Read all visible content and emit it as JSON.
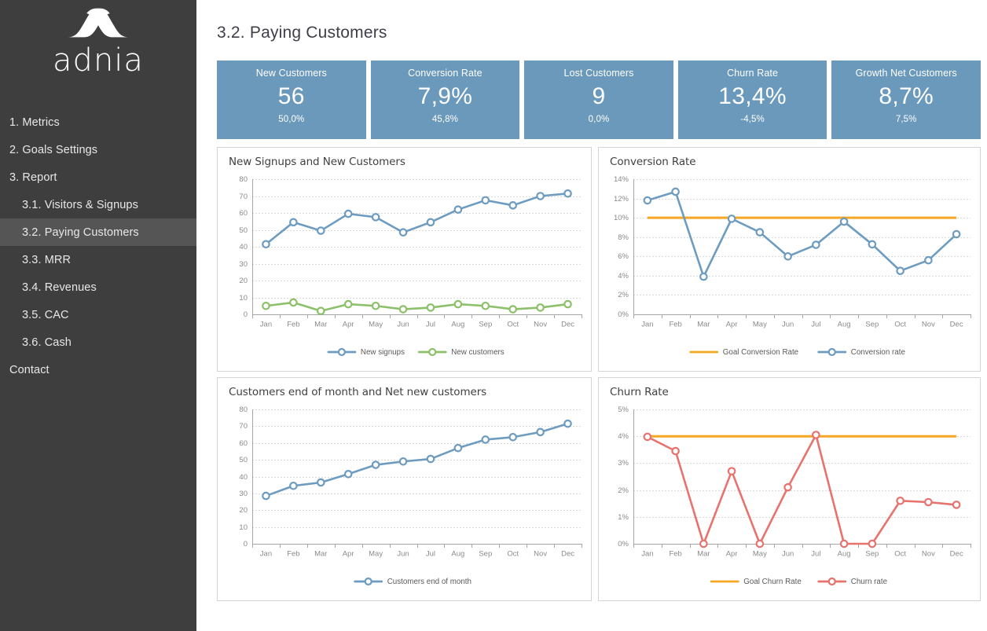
{
  "brand": {
    "name": "adnia",
    "logo_icon": "adnia-ribbon-logo"
  },
  "sidebar": {
    "items": [
      {
        "label": "1. Metrics",
        "level": 0,
        "active": false
      },
      {
        "label": "2. Goals Settings",
        "level": 0,
        "active": false
      },
      {
        "label": "3. Report",
        "level": 0,
        "active": false
      },
      {
        "label": "3.1. Visitors & Signups",
        "level": 1,
        "active": false
      },
      {
        "label": "3.2. Paying Customers",
        "level": 1,
        "active": true
      },
      {
        "label": "3.3. MRR",
        "level": 1,
        "active": false
      },
      {
        "label": "3.4. Revenues",
        "level": 1,
        "active": false
      },
      {
        "label": "3.5. CAC",
        "level": 1,
        "active": false
      },
      {
        "label": "3.6. Cash",
        "level": 1,
        "active": false
      },
      {
        "label": "Contact",
        "level": 0,
        "active": false
      }
    ]
  },
  "page": {
    "title": "3.2. Paying Customers"
  },
  "kpis": [
    {
      "label": "New Customers",
      "value": "56",
      "sub": "50,0%"
    },
    {
      "label": "Conversion Rate",
      "value": "7,9%",
      "sub": "45,8%"
    },
    {
      "label": "Lost Customers",
      "value": "9",
      "sub": "0,0%"
    },
    {
      "label": "Churn Rate",
      "value": "13,4%",
      "sub": "-4,5%"
    },
    {
      "label": "Growth Net Customers",
      "value": "8,7%",
      "sub": "7,5%"
    }
  ],
  "colors": {
    "kpi_card": "#6b99bb",
    "sidebar": "#3e3e3e",
    "sidebar_active": "#555555",
    "blue": "#6e9cc0",
    "green": "#8cc06a",
    "orange": "#f5a623",
    "red": "#e8736e",
    "grid": "#d9d9d9",
    "axis": "#a6a6a6",
    "tick_text": "#8a8a8a"
  },
  "chart_data": [
    {
      "id": "new-signups-and-new-customers",
      "type": "line",
      "title": "New Signups and New Customers",
      "categories": [
        "Jan",
        "Feb",
        "Mar",
        "Apr",
        "May",
        "Jun",
        "Jul",
        "Aug",
        "Sep",
        "Oct",
        "Nov",
        "Dec"
      ],
      "series": [
        {
          "name": "New signups",
          "color": "#6e9cc0",
          "marker": true,
          "values": [
            41.5,
            54.5,
            49.5,
            59.5,
            57.5,
            48.5,
            54.5,
            62,
            67.5,
            64.5,
            70,
            71.5
          ]
        },
        {
          "name": "New customers",
          "color": "#8cc06a",
          "marker": true,
          "values": [
            5,
            7,
            2,
            6,
            5,
            3,
            4,
            6,
            5,
            3,
            4,
            6
          ]
        }
      ],
      "ylim": [
        0,
        80
      ],
      "yticks": [
        0,
        10,
        20,
        30,
        40,
        50,
        60,
        70,
        80
      ],
      "ytick_labels": [
        "0",
        "10",
        "20",
        "30",
        "40",
        "50",
        "60",
        "70",
        "80"
      ],
      "xlabel": "",
      "ylabel": "",
      "grid": true,
      "legend": "bottom"
    },
    {
      "id": "conversion-rate",
      "type": "line",
      "title": "Conversion Rate",
      "categories": [
        "Jan",
        "Feb",
        "Mar",
        "Apr",
        "May",
        "Jun",
        "Jul",
        "Aug",
        "Sep",
        "Oct",
        "Nov",
        "Dec"
      ],
      "series": [
        {
          "name": "Goal Conversion Rate",
          "color": "#f5a623",
          "marker": false,
          "goal": true,
          "values": [
            10,
            10,
            10,
            10,
            10,
            10,
            10,
            10,
            10,
            10,
            10,
            10
          ]
        },
        {
          "name": "Conversion rate",
          "color": "#6e9cc0",
          "marker": true,
          "values": [
            11.8,
            12.7,
            3.9,
            9.9,
            8.5,
            6.0,
            7.2,
            9.6,
            7.25,
            4.5,
            5.6,
            8.3
          ]
        }
      ],
      "ylim": [
        0,
        14
      ],
      "yticks": [
        0,
        2,
        4,
        6,
        8,
        10,
        12,
        14
      ],
      "ytick_labels": [
        "0%",
        "2%",
        "4%",
        "6%",
        "8%",
        "10%",
        "12%",
        "14%"
      ],
      "xlabel": "",
      "ylabel": "",
      "grid": true,
      "legend": "bottom"
    },
    {
      "id": "customers-end-of-month",
      "type": "line",
      "title": "Customers end of month  and Net new customers",
      "categories": [
        "Jan",
        "Feb",
        "Mar",
        "Apr",
        "May",
        "Jun",
        "Jul",
        "Aug",
        "Sep",
        "Oct",
        "Nov",
        "Dec"
      ],
      "series": [
        {
          "name": "Customers end of month",
          "color": "#6e9cc0",
          "marker": true,
          "values": [
            28.5,
            34.5,
            36.5,
            41.5,
            47,
            49,
            50.5,
            57,
            62,
            63.5,
            66.5,
            71.5
          ]
        }
      ],
      "ylim": [
        0,
        80
      ],
      "yticks": [
        0,
        10,
        20,
        30,
        40,
        50,
        60,
        70,
        80
      ],
      "ytick_labels": [
        "0",
        "10",
        "20",
        "30",
        "40",
        "50",
        "60",
        "70",
        "80"
      ],
      "xlabel": "",
      "ylabel": "",
      "grid": true,
      "legend": "bottom"
    },
    {
      "id": "churn-rate",
      "type": "line",
      "title": "Churn Rate",
      "categories": [
        "Jan",
        "Feb",
        "Mar",
        "Apr",
        "May",
        "Jun",
        "Jul",
        "Aug",
        "Sep",
        "Oct",
        "Nov",
        "Dec"
      ],
      "series": [
        {
          "name": "Goal Churn Rate",
          "color": "#f5a623",
          "marker": false,
          "goal": true,
          "values": [
            4,
            4,
            4,
            4,
            4,
            4,
            4,
            4,
            4,
            4,
            4,
            4
          ]
        },
        {
          "name": "Churn rate",
          "color": "#e8736e",
          "marker": true,
          "values": [
            3.98,
            3.45,
            0,
            2.7,
            0,
            2.1,
            4.05,
            0,
            0,
            1.6,
            1.55,
            1.45
          ]
        }
      ],
      "ylim": [
        0,
        5
      ],
      "yticks": [
        0,
        1,
        2,
        3,
        4,
        5
      ],
      "ytick_labels": [
        "0%",
        "1%",
        "2%",
        "3%",
        "4%",
        "5%"
      ],
      "xlabel": "",
      "ylabel": "",
      "grid": true,
      "legend": "bottom"
    }
  ]
}
